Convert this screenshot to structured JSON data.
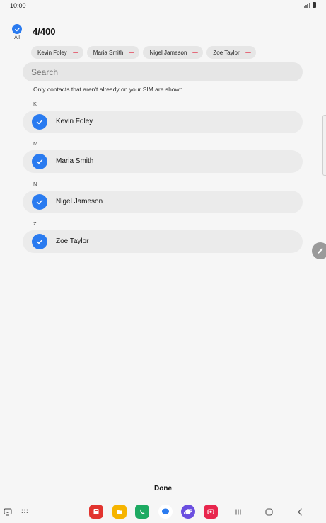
{
  "status_bar": {
    "time": "10:00"
  },
  "header": {
    "select_all_label": "All",
    "count": "4/400"
  },
  "chips": [
    {
      "label": "Kevin Foley"
    },
    {
      "label": "Maria Smith"
    },
    {
      "label": "Nigel Jameson"
    },
    {
      "label": "Zoe Taylor"
    }
  ],
  "search": {
    "placeholder": "Search"
  },
  "notice": "Only contacts that aren't already on your SIM are shown.",
  "groups": [
    {
      "letter": "K",
      "contact": "Kevin Foley"
    },
    {
      "letter": "M",
      "contact": "Maria Smith"
    },
    {
      "letter": "N",
      "contact": "Nigel Jameson"
    },
    {
      "letter": "Z",
      "contact": "Zoe Taylor"
    }
  ],
  "done_label": "Done",
  "colors": {
    "accent": "#2a7bf0",
    "chip_remove": "#e46a7a"
  },
  "nav": {
    "apps": [
      "notes-app-icon",
      "files-app-icon",
      "phone-app-icon",
      "messages-app-icon",
      "internet-app-icon",
      "camera-app-icon"
    ]
  }
}
